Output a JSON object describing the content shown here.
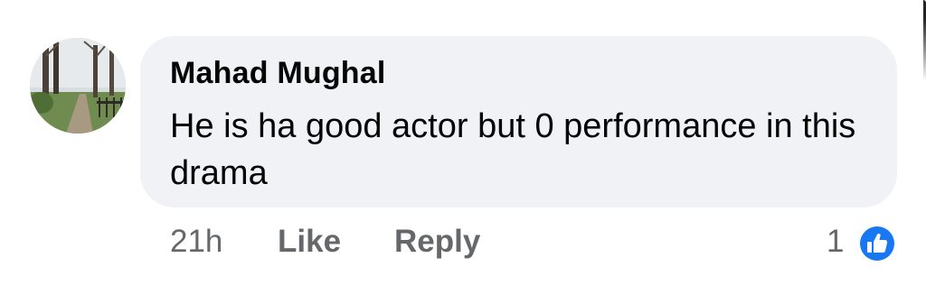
{
  "comment": {
    "author": "Mahad Mughal",
    "text": "He is ha good actor but 0 performance in this drama",
    "timestamp": "21h",
    "actions": {
      "like_label": "Like",
      "reply_label": "Reply"
    },
    "reactions": {
      "count": "1",
      "icon": "like-reaction-icon",
      "color": "#1877f2"
    }
  },
  "colors": {
    "bubble": "#f0f2f5",
    "text": "#050505",
    "meta": "#65676b"
  }
}
